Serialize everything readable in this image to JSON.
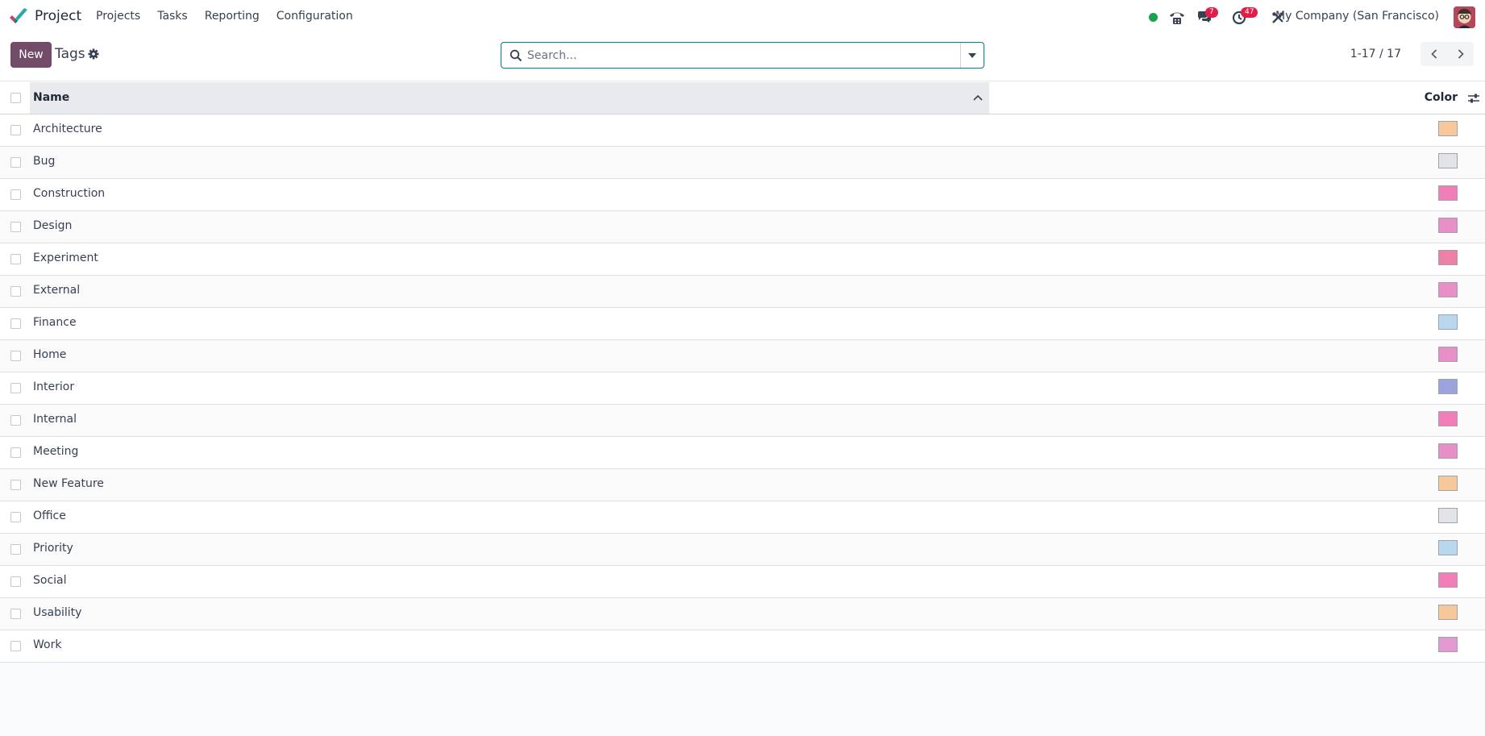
{
  "app": {
    "name": "Project"
  },
  "menu": [
    "Projects",
    "Tasks",
    "Reporting",
    "Configuration"
  ],
  "systray": {
    "messages_count": "7",
    "activities_count": "47",
    "company": "My Company (San Francisco)"
  },
  "control": {
    "new_label": "New",
    "title": "Tags",
    "search_placeholder": "Search...",
    "pager": "1-17 / 17"
  },
  "table": {
    "columns": {
      "name": "Name",
      "color": "Color"
    },
    "rows": [
      {
        "name": "Architecture",
        "color": "#f6c89a"
      },
      {
        "name": "Bug",
        "color": "#e2e4e8"
      },
      {
        "name": "Construction",
        "color": "#f27eb7"
      },
      {
        "name": "Design",
        "color": "#e78fc6"
      },
      {
        "name": "Experiment",
        "color": "#ee7fa6"
      },
      {
        "name": "External",
        "color": "#e78fc6"
      },
      {
        "name": "Finance",
        "color": "#b9d7ee"
      },
      {
        "name": "Home",
        "color": "#e78fc6"
      },
      {
        "name": "Interior",
        "color": "#9da4dd"
      },
      {
        "name": "Internal",
        "color": "#f27eb7"
      },
      {
        "name": "Meeting",
        "color": "#e78fc6"
      },
      {
        "name": "New Feature",
        "color": "#f6c89a"
      },
      {
        "name": "Office",
        "color": "#e2e4e8"
      },
      {
        "name": "Priority",
        "color": "#b9d7ee"
      },
      {
        "name": "Social",
        "color": "#f27eb7"
      },
      {
        "name": "Usability",
        "color": "#f6c89a"
      },
      {
        "name": "Work",
        "color": "#e29ad0"
      }
    ]
  },
  "colors": {
    "brand": "#714b67",
    "focus": "#017e84",
    "badge": "#e11d48",
    "online": "#16a34a"
  }
}
